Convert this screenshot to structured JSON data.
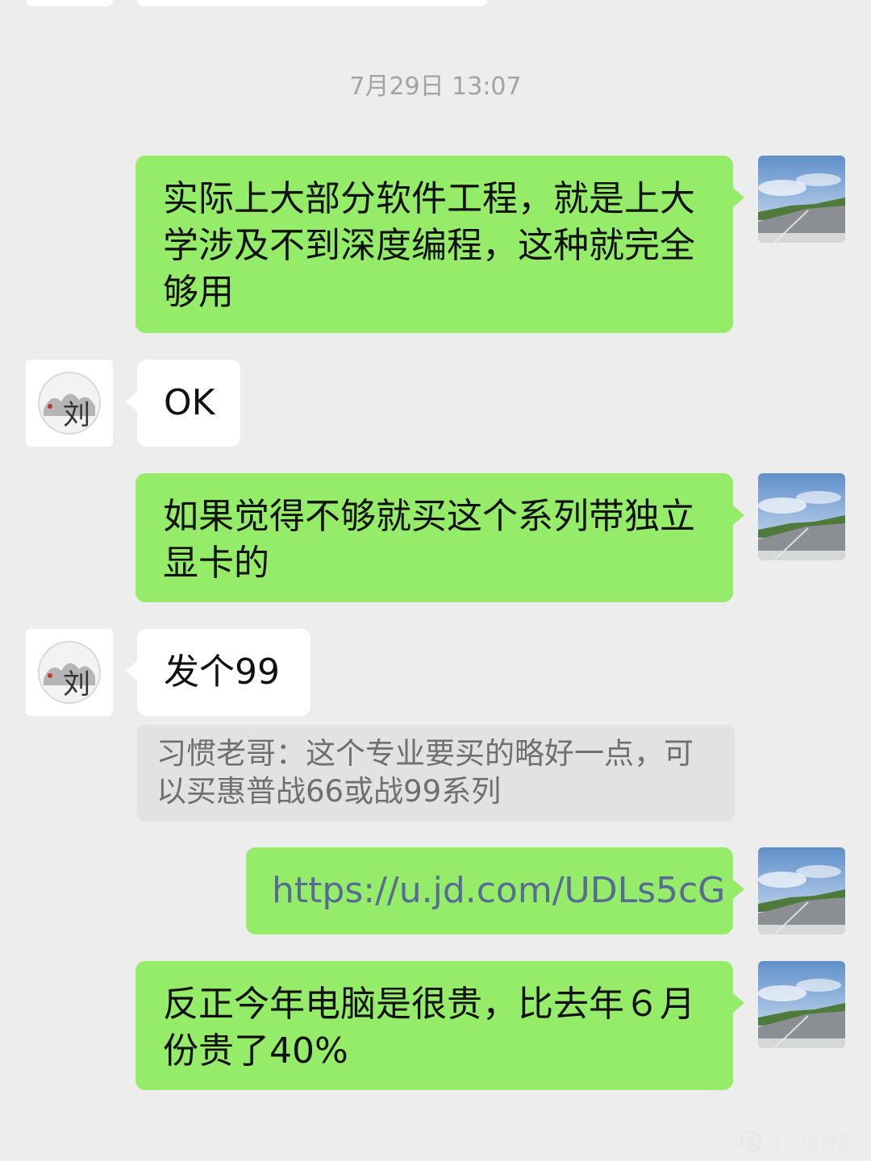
{
  "timestamp": "7月29日 13:07",
  "messages": [
    {
      "sender": "me",
      "text": "实际上大部分软件工程，就是上大学涉及不到深度编程，这种就完全够用"
    },
    {
      "sender": "other",
      "text": "OK"
    },
    {
      "sender": "me",
      "text": "如果觉得不够就买这个系列带独立显卡的"
    },
    {
      "sender": "other",
      "text": "发个99"
    },
    {
      "quote": "习惯老哥：这个专业要买的略好一点，可以买惠普战66或战99系列"
    },
    {
      "sender": "me",
      "text": "https://u.jd.com/UDLs5cG",
      "is_link": true
    },
    {
      "sender": "me",
      "text": "反正今年电脑是很贵，比去年６月份贵了40%"
    }
  ],
  "avatars": {
    "me": "landscape-road-avatar",
    "other": "ink-painting-avatar"
  },
  "watermark": {
    "icon": "值",
    "text": "什么值得买"
  },
  "colors": {
    "background": "#ededed",
    "my_bubble": "#95ec69",
    "other_bubble": "#ffffff",
    "quote_bg": "#e2e2e2",
    "link": "#576b95"
  }
}
